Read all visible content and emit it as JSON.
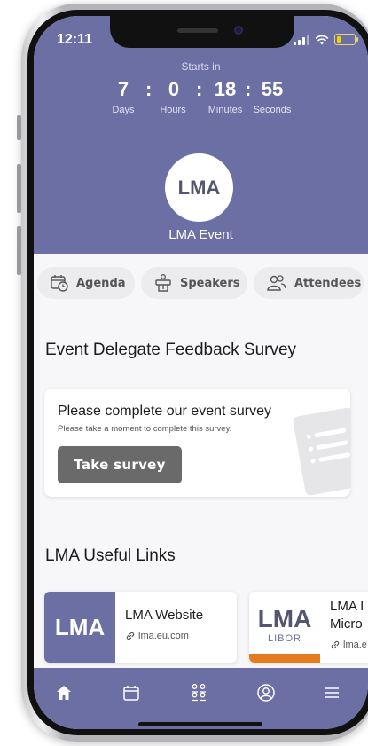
{
  "status_bar": {
    "time": "12:11"
  },
  "countdown": {
    "title": "Starts in",
    "days": "7",
    "hours": "0",
    "minutes": "18",
    "seconds": "55",
    "labels": {
      "days": "Days",
      "hours": "Hours",
      "minutes": "Minutes",
      "seconds": "Seconds"
    }
  },
  "event": {
    "logo_text": "LMA",
    "name": "LMA Event"
  },
  "quick_links": [
    {
      "label": "Agenda",
      "icon": "calendar-clock-icon"
    },
    {
      "label": "Speakers",
      "icon": "podium-icon"
    },
    {
      "label": "Attendees",
      "icon": "people-icon"
    }
  ],
  "survey": {
    "section_title": "Event Delegate Feedback Survey",
    "heading": "Please complete our event survey",
    "subtext": "Please take a moment to complete this survey.",
    "button": "Take survey"
  },
  "links": {
    "section_title": "LMA Useful Links",
    "items": [
      {
        "thumb": "LMA",
        "title": "LMA Website",
        "url": "lma.eu.com"
      },
      {
        "thumb": "LMA",
        "thumb_sub": "LIBOR",
        "title": "LMA I",
        "title2": "Micro",
        "url": "lma.e"
      }
    ]
  },
  "tab_bar": {
    "icons": [
      "home-icon",
      "calendar-icon",
      "people-icon",
      "profile-icon",
      "menu-icon"
    ]
  },
  "colors": {
    "brand": "#6b6fa3",
    "button": "#6a6a6a",
    "accent_orange": "#e57b1f"
  }
}
